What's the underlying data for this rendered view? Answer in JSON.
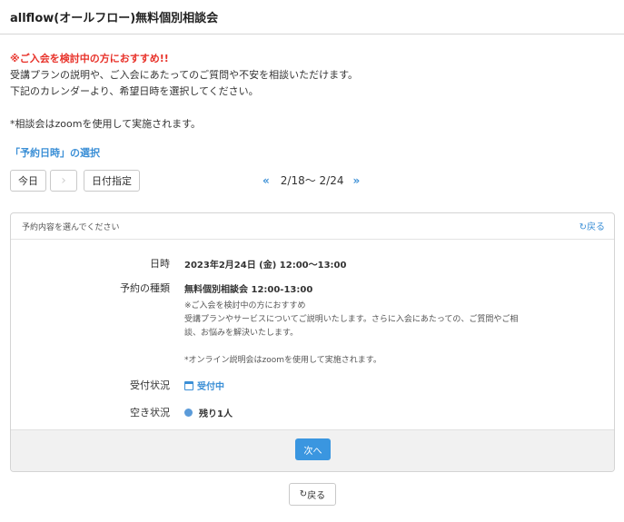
{
  "header": {
    "title": "allflow(オールフロー)無料個別相談会"
  },
  "intro": {
    "warning": "※ご入会を検討中の方におすすめ!!",
    "line1": "受講プランの説明や、ご入会にあたってのご質問や不安を相談いただけます。",
    "line2": "下記のカレンダーより、希望日時を選択してください。",
    "note": "*相談会はzoomを使用して実施されます。"
  },
  "section": {
    "title": "「予約日時」の選択"
  },
  "nav": {
    "today_label": "今日",
    "next_icon": "›",
    "date_label": "日付指定",
    "prev_chevron": "«",
    "range": "2/18〜 2/24",
    "next_chevron": "»"
  },
  "panel": {
    "heading": "予約内容を選んでください",
    "back_label": "戻る",
    "back_icon": "↻",
    "datetime_label": "日時",
    "datetime_value": "2023年2月24日 (金) 12:00〜13:00",
    "type_label": "予約の種類",
    "type_value": "無料個別相談会 12:00-13:00",
    "desc_line1": "※ご入会を検討中の方におすすめ",
    "desc_line2": "受講プランやサービスについてご説明いたします。さらに入会にあたっての、ご質問やご相",
    "desc_line3": "談、お悩みを解決いたします。",
    "desc_line4": "*オンライン説明会はzoomを使用して実施されます。",
    "reception_label": "受付状況",
    "reception_value": "受付中",
    "availability_label": "空き状況",
    "availability_value": "残り1人",
    "next_button": "次へ"
  },
  "footer": {
    "back_icon": "↻",
    "back_label": "戻る"
  },
  "colors": {
    "accent": "#3a96e0",
    "warning": "#e8322a",
    "dot": "#5b9bd9"
  }
}
